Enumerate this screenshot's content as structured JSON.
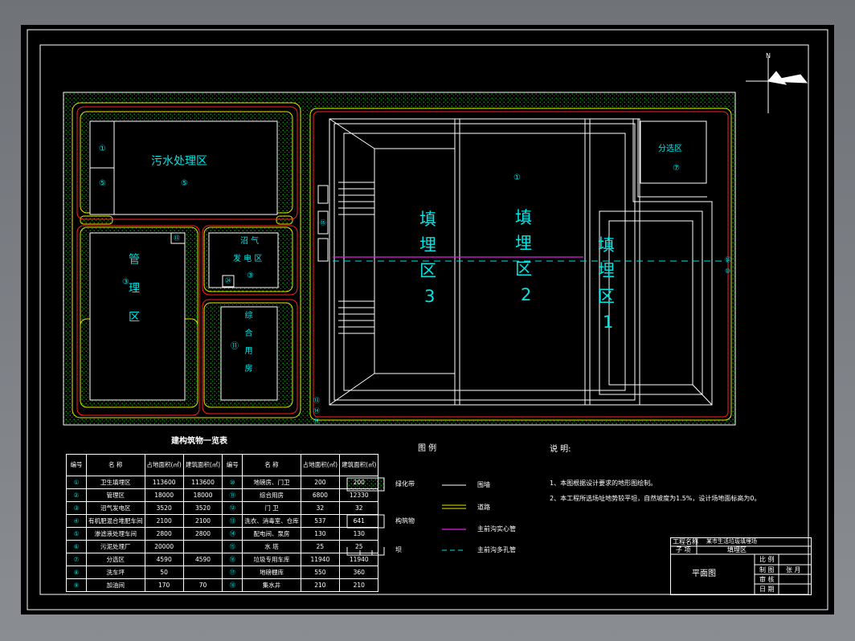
{
  "zones": {
    "sewage": {
      "label": "污水处理区",
      "num": "⑤"
    },
    "sewage_small1": "①",
    "sewage_small2": "⑤",
    "mgmt": {
      "label": "管理区",
      "num": "③",
      "corner": "⑬"
    },
    "biogas": {
      "label1": "沼 气",
      "label2": "发 电 区",
      "num": "③",
      "sub": "㉔"
    },
    "general": {
      "label": "综合用房",
      "num": "⑪"
    },
    "sort": {
      "label": "分选区",
      "num": "⑦"
    },
    "fill3": {
      "label1": "填",
      "label2": "埋",
      "label3": "区",
      "label4": "3"
    },
    "fill2": {
      "label1": "填",
      "label2": "埋",
      "label3": "区",
      "label4": "2",
      "num": "①"
    },
    "fill1": {
      "label1": "填",
      "label2": "埋",
      "label3": "区",
      "label4": "1"
    },
    "gate_left": "⑮",
    "gate_right": "⑯",
    "gate_right2": "⑩",
    "bottom_marks": [
      "⑬",
      "⑭",
      "⑮"
    ]
  },
  "compass": {
    "north": "N"
  },
  "table": {
    "title": "建构筑物一览表",
    "headers": [
      "编号",
      "名 称",
      "占地面积(㎡)",
      "建筑面积(㎡)",
      "编号",
      "名 称",
      "占地面积(㎡)",
      "建筑面积(㎡)"
    ],
    "rows": [
      [
        "①",
        "卫生填埋区",
        "113600",
        "113600",
        "⑩",
        "地磅房、门卫",
        "200",
        "200"
      ],
      [
        "②",
        "管理区",
        "18000",
        "18000",
        "⑪",
        "综合用房",
        "6800",
        "12330"
      ],
      [
        "③",
        "沼气发电区",
        "3520",
        "3520",
        "⑫",
        "门 卫",
        "32",
        "32"
      ],
      [
        "④",
        "有机肥混合堆肥车间",
        "2100",
        "2100",
        "⑬",
        "洗衣、消毒室、仓库",
        "537",
        "641"
      ],
      [
        "⑤",
        "渗滤液处理车间",
        "2800",
        "2800",
        "⑭",
        "配电间、泵房",
        "130",
        "130"
      ],
      [
        "⑥",
        "污泥处理厂",
        "20000",
        "",
        "⑮",
        "水 塔",
        "25",
        "25"
      ],
      [
        "⑦",
        "分选区",
        "4590",
        "4590",
        "⑯",
        "垃圾专用车库",
        "11940",
        "11940"
      ],
      [
        "⑧",
        "洗车坪",
        "50",
        "",
        "⑰",
        "地磅棚库",
        "550",
        "360"
      ],
      [
        "⑨",
        "加油间",
        "170",
        "70",
        "⑱",
        "集水井",
        "210",
        "210"
      ]
    ]
  },
  "legend": {
    "title": "图 例",
    "items": [
      {
        "label": "绿化带"
      },
      {
        "label": "围墙"
      },
      {
        "label": "道路"
      },
      {
        "label": "构筑物"
      },
      {
        "label": "主前沟实心管"
      },
      {
        "label": "坝"
      },
      {
        "label": "主前沟多孔管"
      }
    ]
  },
  "notes": {
    "title": "说 明:",
    "lines": [
      "1、本图根据设计要求的地形图绘制。",
      "2、本工程所选场址地势较平坦，自然坡度为1.5%，设计场地面标高为0。"
    ]
  },
  "title_block": {
    "proj_label": "工程名称",
    "proj_value": "某市生活垃圾填埋场",
    "sub_label": "子 项",
    "sub_value": "填埋区",
    "drawing_name": "平面图",
    "r1": "比 例",
    "r2": "制 图",
    "r2v": "张 月",
    "r3": "审 核",
    "r4": "日 期"
  },
  "colors": {
    "cyan": "#00e5e5",
    "green": "#00c000",
    "yellow": "#e6e600",
    "red": "#ff2020",
    "magenta": "#e020e0",
    "white": "#ffffff"
  }
}
